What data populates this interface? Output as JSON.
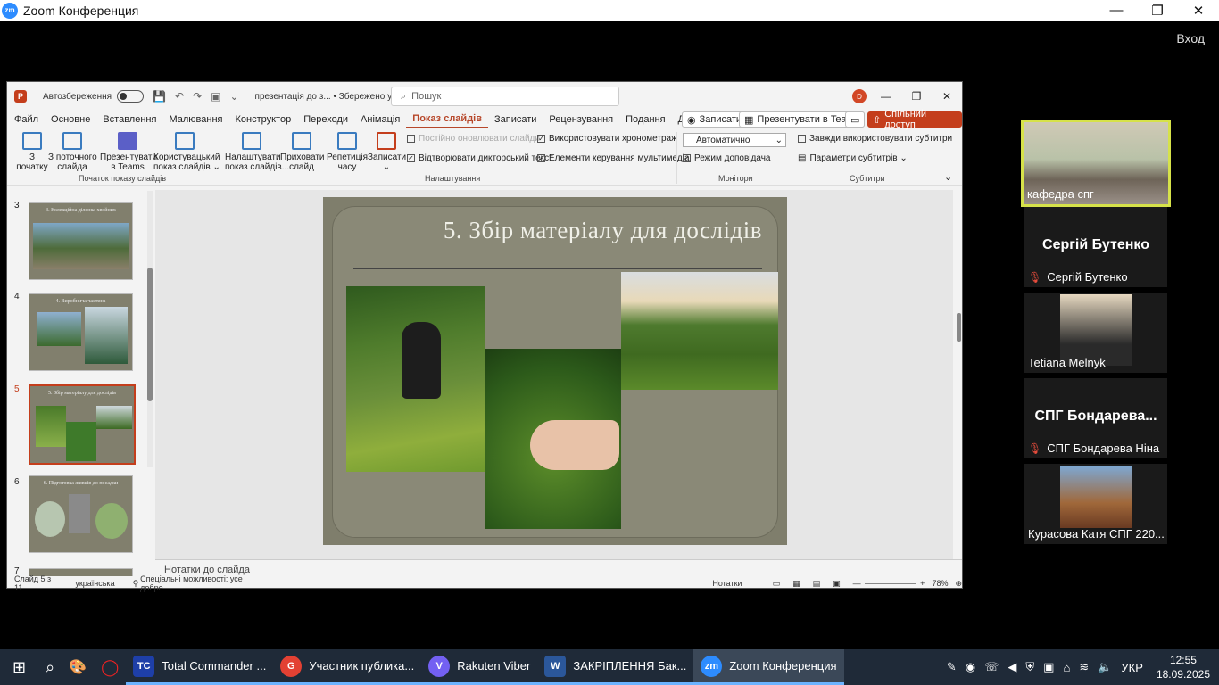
{
  "zoom": {
    "title": "Zoom Конференция",
    "logo": "zm",
    "enter": "Вход",
    "controls": [
      "—",
      "❐",
      "✕"
    ]
  },
  "ppt": {
    "autosave_label": "Автозбереження",
    "doc_name": "презентація до з... • Збережено у цей ПК ⌄",
    "search_placeholder": "Пошук",
    "avatar": "D",
    "menu": [
      "Файл",
      "Основне",
      "Вставлення",
      "Малювання",
      "Конструктор",
      "Переходи",
      "Анімація",
      "Показ слайдів",
      "Записати",
      "Рецензування",
      "Подання",
      "Довідка"
    ],
    "active_menu": "Показ слайдів",
    "record_btn": "Записати",
    "teams_btn": "Презентувати в Teams",
    "share_btn": "Спільний доступ",
    "ribbon": {
      "from_start": "З\nпочатку",
      "from_current": "З поточного\nслайда",
      "present_teams": "Презентувати\nв Teams",
      "custom_show": "Користувацький\nпоказ слайдів ⌄",
      "setup": "Налаштувати\nпоказ слайдів...",
      "hide": "Приховати\nслайд",
      "rehearse": "Репетиція\nчасу",
      "record": "Записати\n⌄",
      "group_start": "Початок показу слайдів",
      "group_settings": "Налаштування",
      "group_monitors": "Монітори",
      "group_subtitles": "Субтитри",
      "chk_update": "Постійно оновлювати слайди",
      "chk_narration": "Відтворювати дикторський текст",
      "chk_timings": "Використовувати хронометраж",
      "chk_media": "Елементи керування мультимедіа",
      "monitor_auto": "Автоматично",
      "chk_presenter": "Режим доповідача",
      "chk_subtitles": "Завжди використовувати субтитри",
      "subtitle_params": "Параметри субтитрів ⌄"
    },
    "thumbnails": [
      {
        "num": "3",
        "caption": "3. Колекційна ділянка хвойних"
      },
      {
        "num": "4",
        "caption": "4. Виробнича частина"
      },
      {
        "num": "5",
        "caption": "5. Збір матеріалу для дослідів"
      },
      {
        "num": "6",
        "caption": "6. Підготовка живців до посадки"
      },
      {
        "num": "7",
        "caption": ""
      }
    ],
    "slide_title": "5. Збір матеріалу для дослідів",
    "notes": "Нотатки до слайда",
    "status": {
      "slide": "Слайд 5 з 11",
      "lang": "українська",
      "access": "Спеціальні можливості: усе добре",
      "notes_btn": "Нотатки",
      "zoom": "78%"
    }
  },
  "participants": [
    {
      "name": "кафедра спг",
      "big": "",
      "muted": false
    },
    {
      "name": "Сергій Бутенко",
      "big": "Сергій Бутенко",
      "muted": true
    },
    {
      "name": "Tetiana Melnyk",
      "big": "",
      "muted": false
    },
    {
      "name": "СПГ Бондарева Ніна",
      "big": "СПГ Бондарева...",
      "muted": true
    },
    {
      "name": "Курасова Катя СПГ 220...",
      "big": "",
      "muted": false
    }
  ],
  "taskbar": {
    "apps": [
      {
        "label": "Total Commander ...",
        "color": "#1e3fa8",
        "icon": "TC"
      },
      {
        "label": "Участник публика...",
        "color": "#e34133",
        "icon": "G"
      },
      {
        "label": "Rakuten Viber",
        "color": "#7360f2",
        "icon": "V"
      },
      {
        "label": "ЗАКРІПЛЕННЯ Бак...",
        "color": "#2b579a",
        "icon": "W"
      },
      {
        "label": "Zoom Конференция",
        "color": "#2d8cff",
        "icon": "zm"
      }
    ],
    "lang": "УКР",
    "time": "12:55",
    "date": "18.09.2025"
  }
}
